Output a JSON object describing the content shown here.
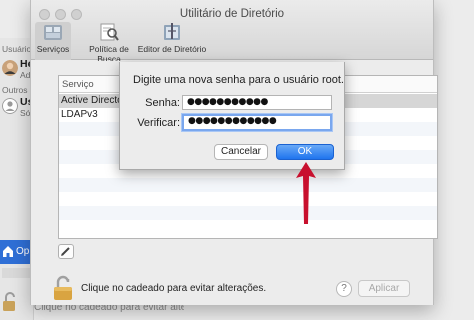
{
  "background_window": {
    "sidebar_header": "Usuário a",
    "user1_name": "He",
    "user1_role": "Adr",
    "others_header": "Outros U",
    "user2_name": "Us",
    "user2_sub": "Só",
    "options_label": "Op",
    "bottom_label": "Clique no cadeado para evitar alterações."
  },
  "window": {
    "title": "Utilitário de Diretório"
  },
  "toolbar": {
    "items": [
      {
        "label": "Serviços",
        "icon": "services-icon",
        "selected": true
      },
      {
        "label": "Política de Busca",
        "icon": "magnifier-doc-icon"
      },
      {
        "label": "Editor de Diretório",
        "icon": "directory-editor-icon"
      }
    ]
  },
  "services_table": {
    "header": "Serviço",
    "rows": [
      {
        "name": "Active Directory",
        "selected": true
      },
      {
        "name": "LDAPv3",
        "selected": false
      }
    ]
  },
  "sheet": {
    "prompt": "Digite uma nova senha para o usuário root.",
    "password_label": "Senha:",
    "password_value": "●●●●●●●●●●●",
    "verify_label": "Verificar:",
    "verify_value": "●●●●●●●●●●●●",
    "cancel_label": "Cancelar",
    "ok_label": "OK"
  },
  "footer": {
    "lock_text": "Clique no cadeado para evitar alterações.",
    "help_label": "?",
    "apply_label": "Aplicar"
  },
  "colors": {
    "accent_blue": "#1f74ee",
    "annotation_red": "#c8102e"
  }
}
